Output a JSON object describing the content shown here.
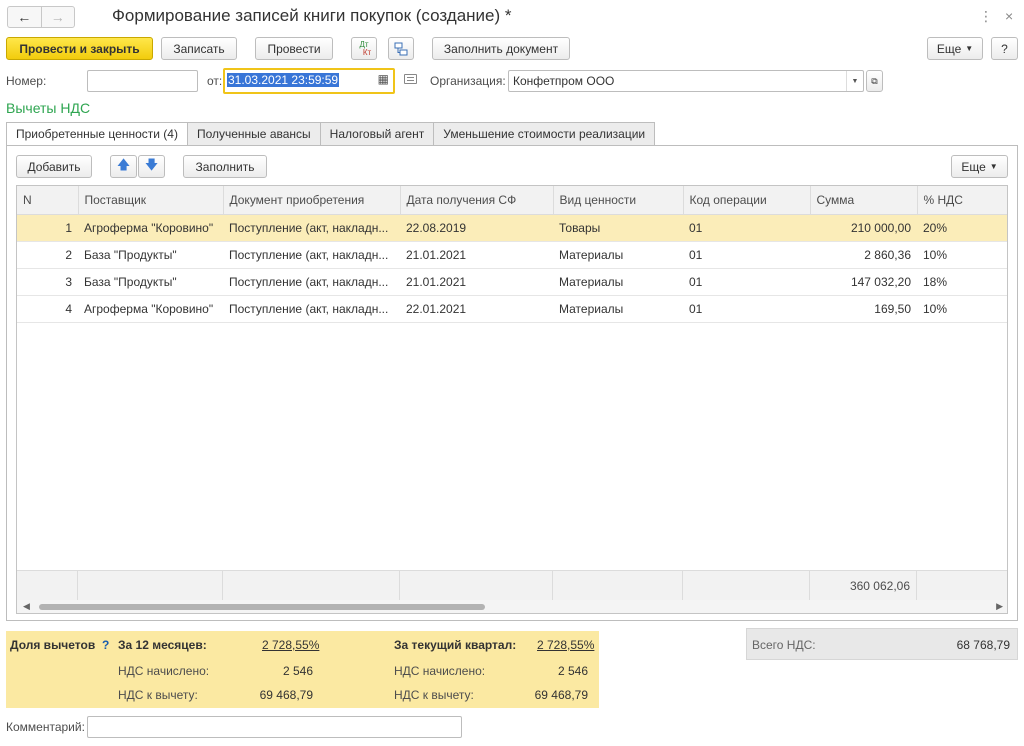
{
  "window": {
    "title": "Формирование записей книги покупок (создание) *"
  },
  "toolbar": {
    "post_close": "Провести и закрыть",
    "save": "Записать",
    "post": "Провести",
    "dt_kt_top": "Дт",
    "dt_kt_bottom": "Кт",
    "fill_document": "Заполнить документ",
    "more": "Еще",
    "help": "?"
  },
  "header": {
    "number_label": "Номер:",
    "number_value": "",
    "date_label": "от:",
    "date_value": "31.03.2021 23:59:59",
    "org_label": "Организация:",
    "org_value": "Конфетпром ООО"
  },
  "section_title": "Вычеты НДС",
  "tabs": [
    {
      "label": "Приобретенные ценности (4)",
      "active": true
    },
    {
      "label": "Полученные авансы",
      "active": false
    },
    {
      "label": "Налоговый агент",
      "active": false
    },
    {
      "label": "Уменьшение стоимости реализации",
      "active": false
    }
  ],
  "table_toolbar": {
    "add": "Добавить",
    "fill": "Заполнить",
    "more": "Еще"
  },
  "table": {
    "columns": [
      "N",
      "Поставщик",
      "Документ приобретения",
      "Дата получения СФ",
      "Вид ценности",
      "Код операции",
      "Сумма",
      "% НДС"
    ],
    "rows": [
      [
        "1",
        "Агроферма \"Коровино\"",
        "Поступление (акт, накладн...",
        "22.08.2019",
        "Товары",
        "01",
        "210 000,00",
        "20%"
      ],
      [
        "2",
        "База \"Продукты\"",
        "Поступление (акт, накладн...",
        "21.01.2021",
        "Материалы",
        "01",
        "2 860,36",
        "10%"
      ],
      [
        "3",
        "База \"Продукты\"",
        "Поступление (акт, накладн...",
        "21.01.2021",
        "Материалы",
        "01",
        "147 032,20",
        "18%"
      ],
      [
        "4",
        "Агроферма \"Коровино\"",
        "Поступление (акт, накладн...",
        "22.01.2021",
        "Материалы",
        "01",
        "169,50",
        "10%"
      ]
    ],
    "selected_row": 0,
    "total_sum": "360 062,06"
  },
  "summary": {
    "share_label": "Доля вычетов",
    "share_help": "?",
    "period12_label": "За 12 месяцев:",
    "period12_value": "2 728,55%",
    "quarter_label": "За текущий квартал:",
    "quarter_value": "2 728,55%",
    "vat_accrued_label": "НДС начислено:",
    "vat_accrued_12": "2 546",
    "vat_accrued_q": "2 546",
    "vat_deduct_label": "НДС к вычету:",
    "vat_deduct_12": "69 468,79",
    "vat_deduct_q": "69 468,79"
  },
  "total_vat": {
    "label": "Всего НДС:",
    "value": "68 768,79"
  },
  "comment": {
    "label": "Комментарий:",
    "value": ""
  },
  "colors": {
    "primary_button": "#f2cc0d",
    "section_title": "#2ea550",
    "selected_row": "#fbedb9",
    "summary_bg": "#fbe9a2",
    "link": "#1a5dad",
    "date_focus_border": "#f0c419",
    "date_selection": "#3875d7"
  }
}
